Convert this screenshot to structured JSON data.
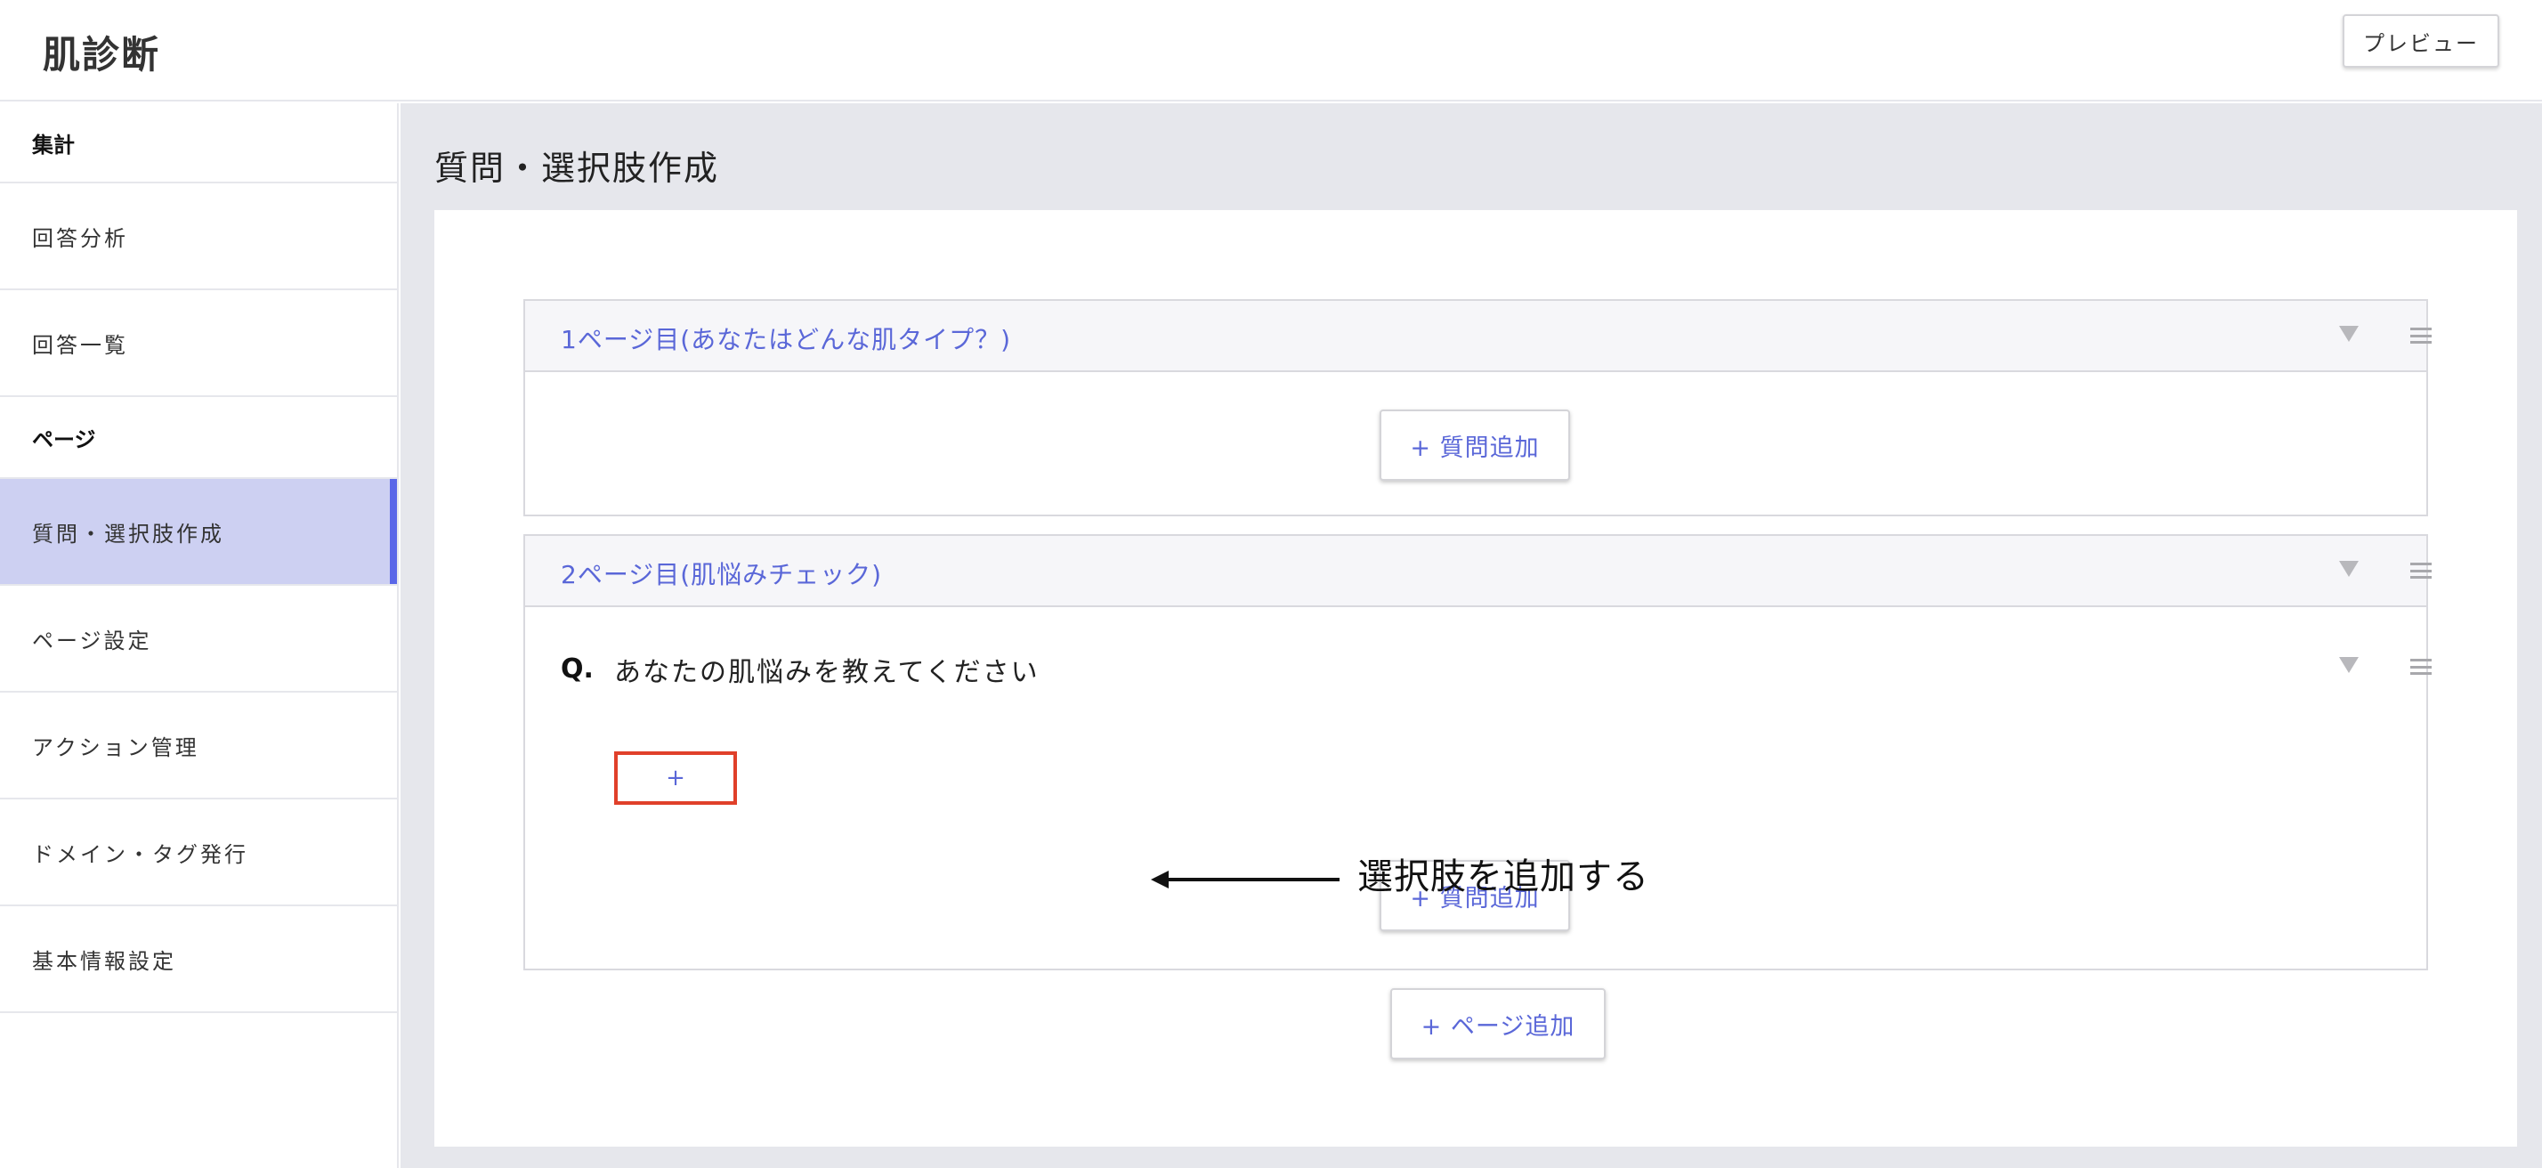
{
  "header": {
    "app_title": "肌診断",
    "preview_label": "プレビュー"
  },
  "sidebar": {
    "sections": [
      {
        "title": "集計",
        "items": [
          {
            "label": "回答分析",
            "active": false
          },
          {
            "label": "回答一覧",
            "active": false
          }
        ]
      },
      {
        "title": "ページ",
        "items": [
          {
            "label": "質問・選択肢作成",
            "active": true
          },
          {
            "label": "ページ設定",
            "active": false
          },
          {
            "label": "アクション管理",
            "active": false
          },
          {
            "label": "ドメイン・タグ発行",
            "active": false
          },
          {
            "label": "基本情報設定",
            "active": false
          }
        ]
      }
    ]
  },
  "main": {
    "page_title": "質問・選択肢作成",
    "pages": [
      {
        "title": "1ページ目(あなたはどんな肌タイプ？)",
        "add_question_label": "+ 質問追加"
      },
      {
        "title": "2ページ目(肌悩みチェック)",
        "question": {
          "prefix": "Q.",
          "text": "あなたの肌悩みを教えてください",
          "add_choice_label": "+"
        },
        "add_question_label": "+ 質問追加"
      }
    ],
    "add_page_label": "+ ページ追加"
  },
  "annotation": {
    "text": "選択肢を追加する"
  },
  "colors": {
    "accent": "#5a67d8",
    "active_bg": "#cdd0f2",
    "active_bar": "#5a67e8",
    "highlight_border": "#e0402a",
    "main_bg": "#e6e7ec"
  },
  "icons": [
    "chevron-down-icon",
    "drag-handle-icon",
    "arrow-left-icon"
  ]
}
